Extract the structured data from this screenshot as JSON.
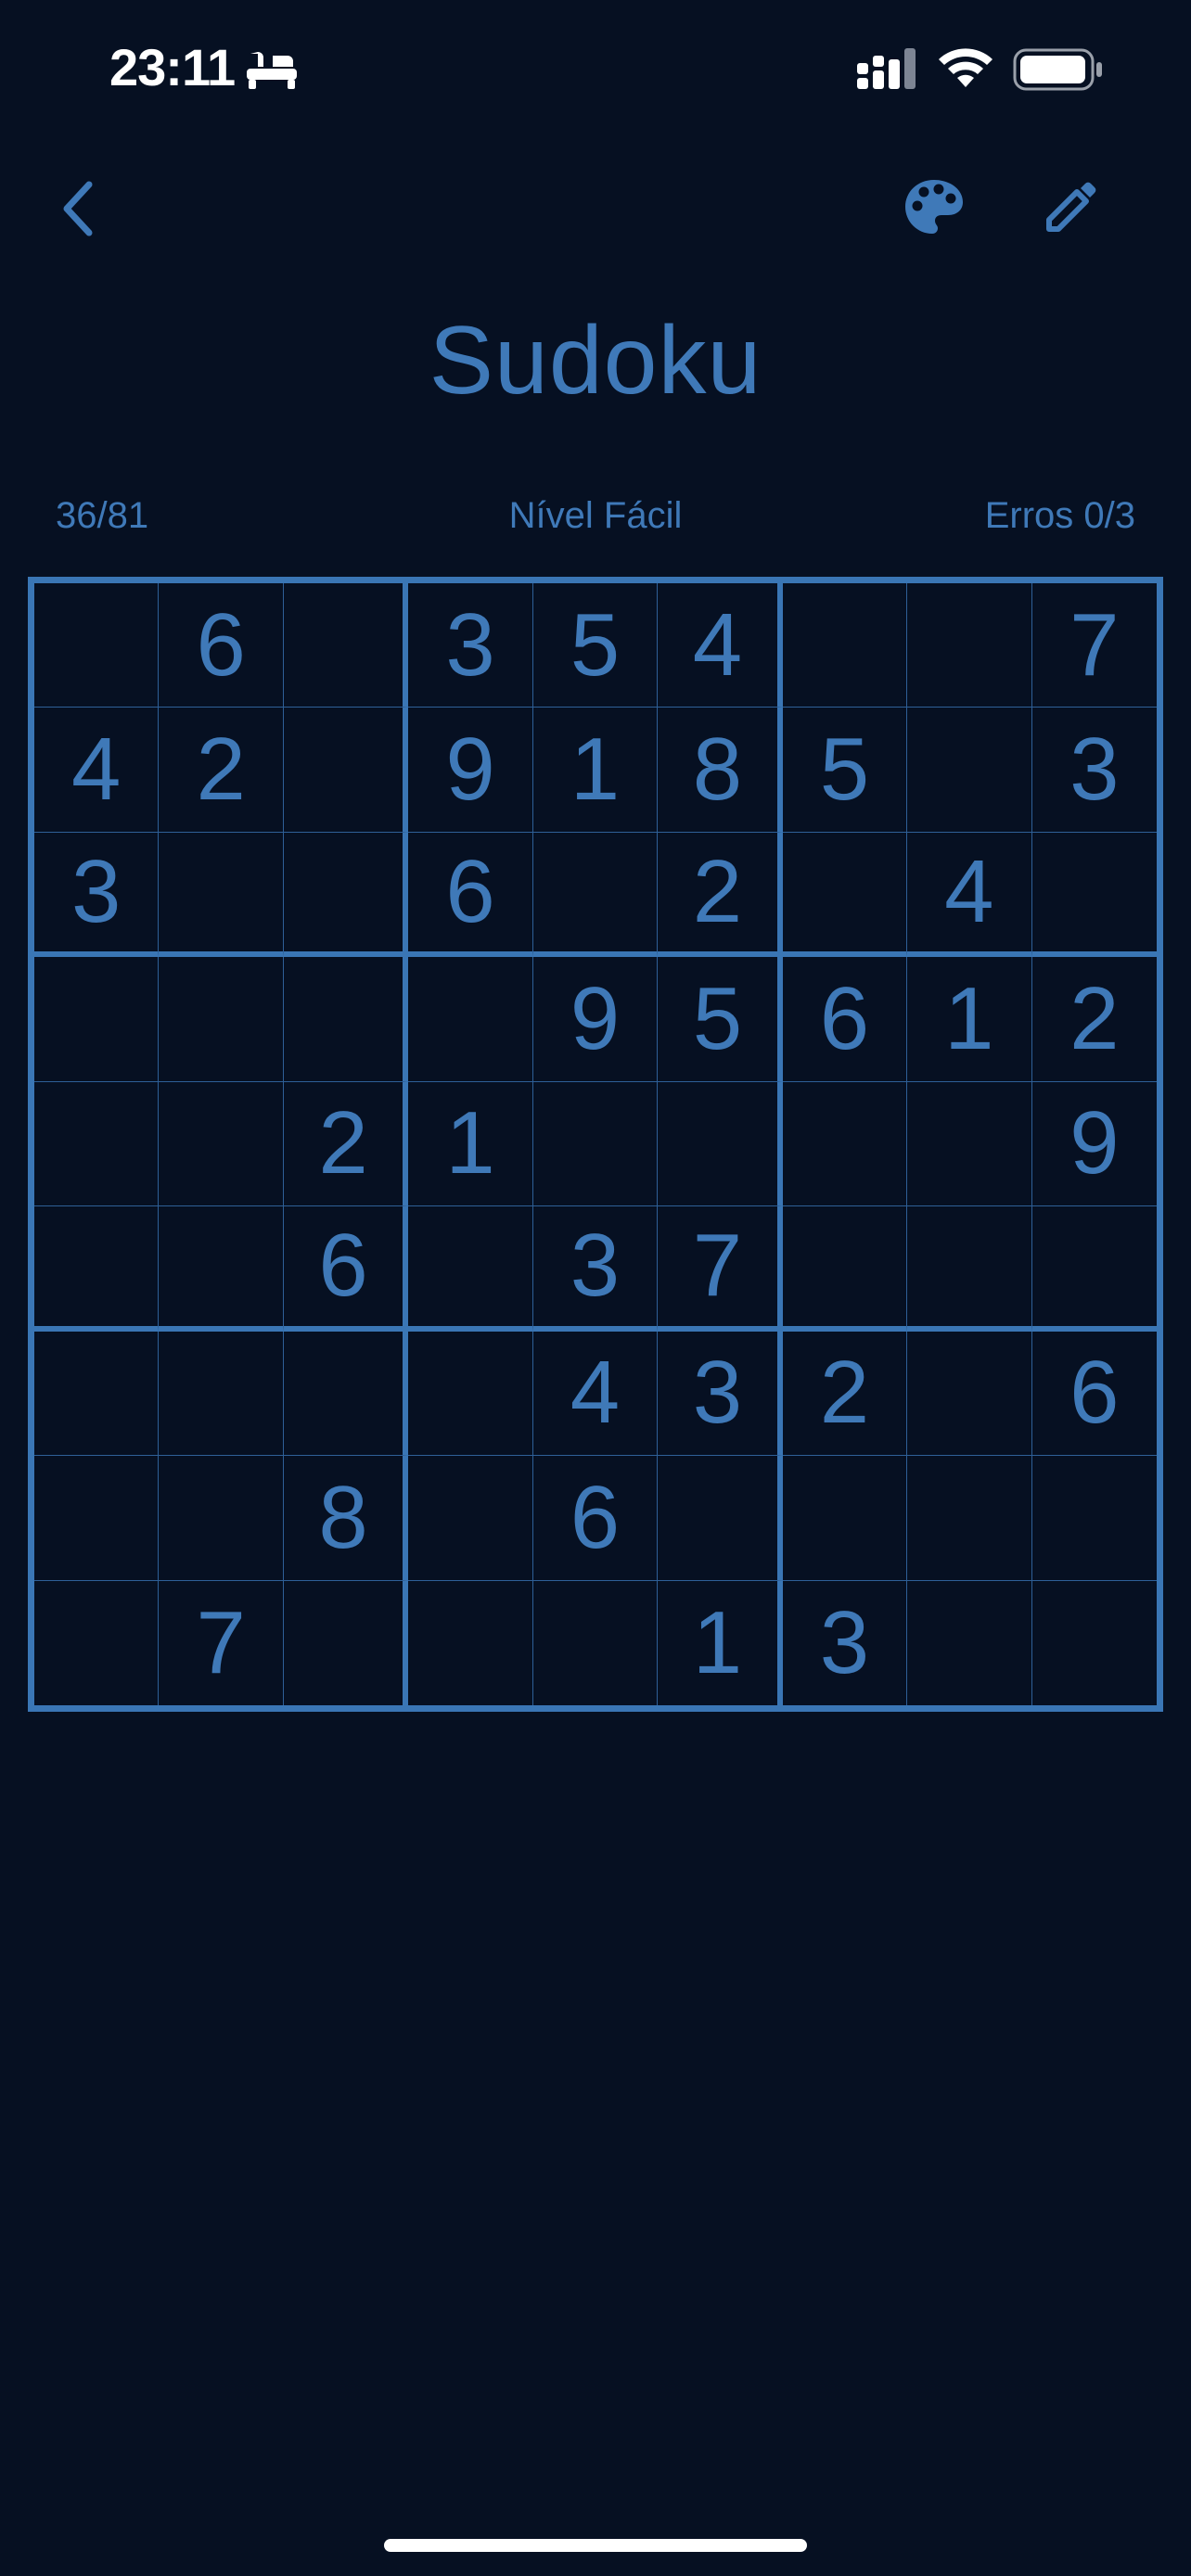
{
  "status_bar": {
    "time": "23:11",
    "icons": [
      "sleep-icon",
      "signal-icon",
      "wifi-icon",
      "battery-icon"
    ]
  },
  "toolbar": {
    "back_icon": "chevron-left-icon",
    "palette_icon": "palette-icon",
    "edit_icon": "pencil-icon"
  },
  "title": "Sudoku",
  "info": {
    "progress": "36/81",
    "level": "Nível Fácil",
    "errors": "Erros 0/3"
  },
  "board": {
    "rows": [
      [
        "",
        "6",
        "",
        "3",
        "5",
        "4",
        "",
        "",
        "7"
      ],
      [
        "4",
        "2",
        "",
        "9",
        "1",
        "8",
        "5",
        "",
        "3"
      ],
      [
        "3",
        "",
        "",
        "6",
        "",
        "2",
        "",
        "4",
        ""
      ],
      [
        "",
        "",
        "",
        "",
        "9",
        "5",
        "6",
        "1",
        "2"
      ],
      [
        "",
        "",
        "2",
        "1",
        "",
        "",
        "",
        "",
        "9"
      ],
      [
        "",
        "",
        "6",
        "",
        "3",
        "7",
        "",
        "",
        ""
      ],
      [
        "",
        "",
        "",
        "",
        "4",
        "3",
        "2",
        "",
        "6"
      ],
      [
        "",
        "",
        "8",
        "",
        "6",
        "",
        "",
        "",
        ""
      ],
      [
        "",
        "7",
        "",
        "",
        "",
        "1",
        "3",
        "",
        ""
      ]
    ]
  },
  "colors": {
    "background": "#061022",
    "accent": "#3f79b8",
    "grid_thick": "#3a76b5",
    "grid_thin": "#2e5f97"
  }
}
